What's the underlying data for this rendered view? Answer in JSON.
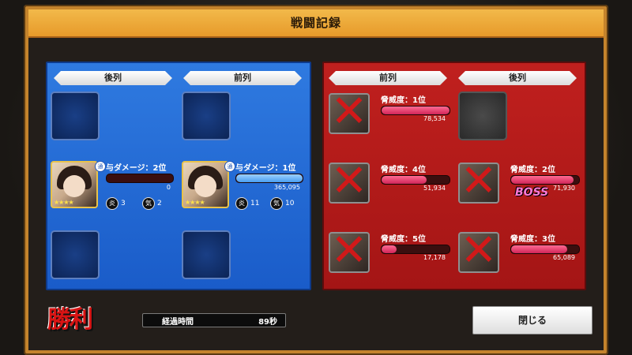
{
  "window_title": "戦闘記録",
  "ally": {
    "rows": [
      "後列",
      "前列"
    ],
    "members": [
      {
        "damage_label": "与ダメージ：2位",
        "value": "0",
        "stat1_icon": "炎",
        "stat1": "3",
        "stat2_icon": "気",
        "stat2": "2",
        "bar_fill": 0.0,
        "badge": "通"
      },
      {
        "damage_label": "与ダメージ：1位",
        "value": "365,095",
        "stat1_icon": "炎",
        "stat1": "11",
        "stat2_icon": "気",
        "stat2": "10",
        "bar_fill": 1.0,
        "badge": "通"
      }
    ]
  },
  "enemy": {
    "rows": [
      "前列",
      "後列"
    ],
    "targets": [
      {
        "threat": "脅威度：1位",
        "value": "78,534",
        "fill": 1.0
      },
      {
        "threat": "脅威度：4位",
        "value": "51,934",
        "fill": 0.66
      },
      {
        "threat": "脅威度：2位",
        "value": "71,930",
        "fill": 0.92
      },
      {
        "threat": "脅威度：5位",
        "value": "17,178",
        "fill": 0.22
      },
      {
        "threat": "脅威度：3位",
        "value": "65,089",
        "fill": 0.83
      }
    ],
    "boss_label": "BOSS"
  },
  "result": {
    "label": "勝利"
  },
  "elapsed": {
    "label": "経過時間",
    "value": "89秒"
  },
  "close_button": "閉じる",
  "colors": {
    "accent": "#e79a2a",
    "ally_panel": "#1a5cc9",
    "enemy_panel": "#a41515"
  }
}
